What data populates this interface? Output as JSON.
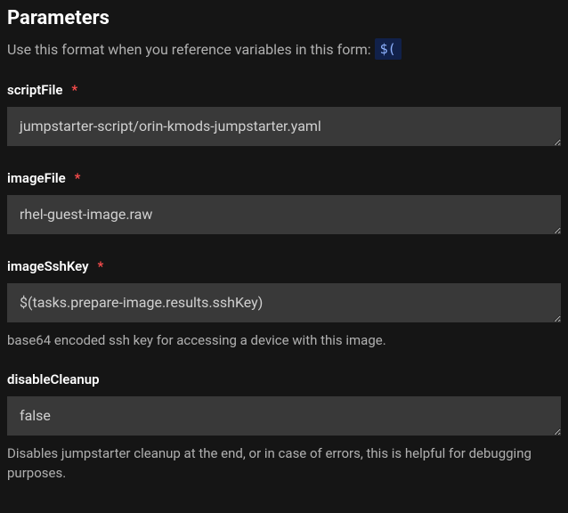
{
  "section": {
    "title": "Parameters",
    "hint": "Use this format when you reference variables in this form:",
    "var_example": "$("
  },
  "fields": {
    "scriptFile": {
      "label": "scriptFile",
      "required": true,
      "value": "jumpstarter-script/orin-kmods-jumpstarter.yaml",
      "help": ""
    },
    "imageFile": {
      "label": "imageFile",
      "required": true,
      "value": "rhel-guest-image.raw",
      "help": ""
    },
    "imageSshKey": {
      "label": "imageSshKey",
      "required": true,
      "value": "$(tasks.prepare-image.results.sshKey)",
      "help": "base64 encoded ssh key for accessing a device with this image."
    },
    "disableCleanup": {
      "label": "disableCleanup",
      "required": false,
      "value": "false",
      "help": "Disables jumpstarter cleanup at the end, or in case of errors, this is helpful for debugging purposes."
    }
  }
}
